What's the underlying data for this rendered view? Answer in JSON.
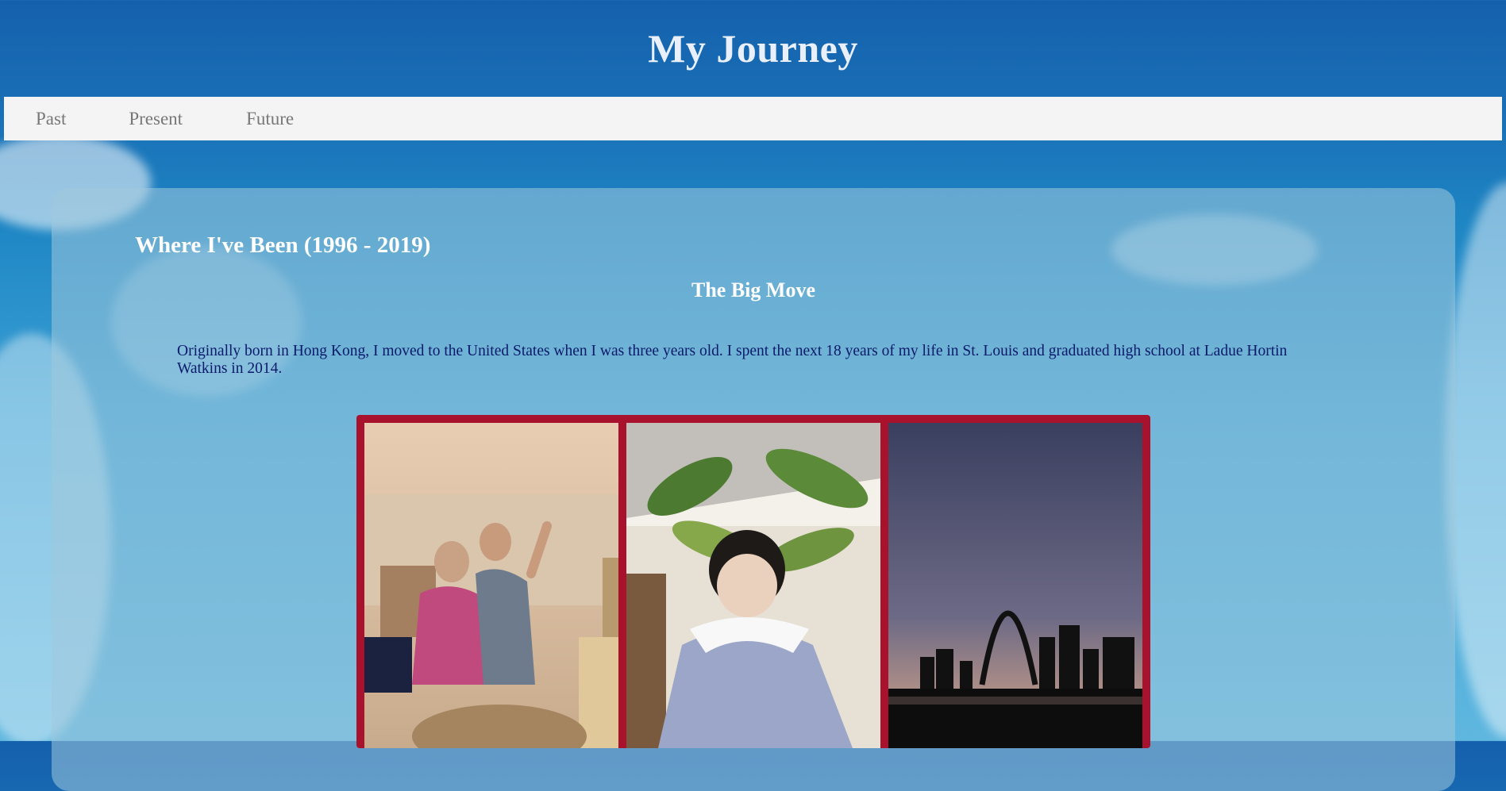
{
  "site": {
    "title": "My Journey"
  },
  "nav": {
    "items": [
      "Past",
      "Present",
      "Future"
    ]
  },
  "section": {
    "title": "Where I've Been (1996 - 2019)",
    "subtitle": "The Big Move",
    "paragraph": "Originally born in Hong Kong, I moved to the United States when I was three years old. I spent the next 18 years of my life in St. Louis and graduated high school at Ladue Hortin Watkins in 2014."
  },
  "gallery": {
    "border_color": "#a8122d",
    "photos": [
      {
        "name": "parents-photo",
        "alt": "Parents waving"
      },
      {
        "name": "child-photo",
        "alt": "Child in blue dress"
      },
      {
        "name": "gateway-arch-photo",
        "alt": "St. Louis Gateway Arch at dusk"
      }
    ]
  },
  "colors": {
    "title_text": "#e9f0fb",
    "nav_bg": "#f4f4f4",
    "nav_text": "#777777",
    "body_text": "#0b1a6a"
  }
}
